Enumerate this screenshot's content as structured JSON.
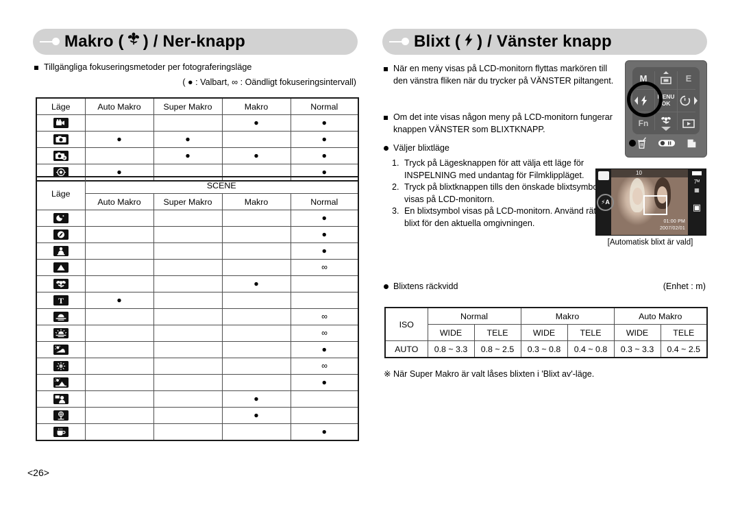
{
  "page": {
    "number": "<26>"
  },
  "left": {
    "header": {
      "title_before": "Makro (",
      "icon": "macro-flower-icon",
      "title_after": ") / Ner-knapp"
    },
    "intro": "Tillgängliga fokuseringsmetoder per fotograferingsläge",
    "legend": "( ● : Valbart,  ∞ : Oändligt fokuseringsintervall)",
    "table1": {
      "headers": [
        "Läge",
        "Auto Makro",
        "Super Makro",
        "Makro",
        "Normal"
      ],
      "rows": [
        {
          "icon": "movie-clip-icon",
          "cells": [
            "",
            "",
            "●",
            "●"
          ]
        },
        {
          "icon": "auto-camera-icon",
          "cells": [
            "●",
            "●",
            "",
            "●"
          ]
        },
        {
          "icon": "program-camera-icon",
          "cells": [
            "",
            "●",
            "●",
            "●"
          ]
        },
        {
          "icon": "voice-recording-icon",
          "cells": [
            "●",
            "",
            "",
            "●"
          ]
        }
      ]
    },
    "table2": {
      "mode_label": "Läge",
      "group_header": "SCENE",
      "sub_headers": [
        "Auto Makro",
        "Super Makro",
        "Makro",
        "Normal"
      ],
      "rows": [
        {
          "icon": "night-icon",
          "cells": [
            "",
            "",
            "",
            "●"
          ]
        },
        {
          "icon": "portrait-icon",
          "cells": [
            "",
            "",
            "",
            "●"
          ]
        },
        {
          "icon": "children-icon",
          "cells": [
            "",
            "",
            "",
            "●"
          ]
        },
        {
          "icon": "landscape-icon",
          "cells": [
            "",
            "",
            "",
            "∞"
          ]
        },
        {
          "icon": "close-up-icon",
          "cells": [
            "",
            "",
            "●",
            ""
          ]
        },
        {
          "icon": "text-icon",
          "cells": [
            "●",
            "",
            "",
            ""
          ]
        },
        {
          "icon": "sunset-icon",
          "cells": [
            "",
            "",
            "",
            "∞"
          ]
        },
        {
          "icon": "dawn-icon",
          "cells": [
            "",
            "",
            "",
            "∞"
          ]
        },
        {
          "icon": "backlight-icon",
          "cells": [
            "",
            "",
            "",
            "●"
          ]
        },
        {
          "icon": "fireworks-icon",
          "cells": [
            "",
            "",
            "",
            "∞"
          ]
        },
        {
          "icon": "beach-snow-icon",
          "cells": [
            "",
            "",
            "",
            "●"
          ]
        },
        {
          "icon": "self-shot-icon",
          "cells": [
            "",
            "",
            "●",
            ""
          ]
        },
        {
          "icon": "food-icon",
          "cells": [
            "",
            "",
            "●",
            ""
          ]
        },
        {
          "icon": "cafe-icon",
          "cells": [
            "",
            "",
            "",
            "●"
          ]
        }
      ]
    }
  },
  "right": {
    "header": {
      "title_before": "Blixt (",
      "icon": "flash-bolt-icon",
      "title_after": ") / Vänster knapp"
    },
    "bullet1": "När en meny visas på LCD-monitorn flyttas markören till den vänstra fliken när du trycker på VÄNSTER piltangent.",
    "bullet2": "Om det inte visas någon meny på LCD-monitorn fungerar knappen VÄNSTER som BLIXTKNAPP.",
    "select_flash_mode": "Väljer blixtläge",
    "steps": [
      {
        "num": "1.",
        "text": "Tryck på Lägesknappen för att välja ett läge för INSPELNING med undantag för Filmklippläget."
      },
      {
        "num": "2.",
        "text": "Tryck på blixtknappen tills den önskade blixtsymbolen visas på LCD-monitorn."
      },
      {
        "num": "3.",
        "text": "En blixtsymbol visas på LCD-monitorn. Använd rätt blixt för den aktuella omgivningen."
      }
    ],
    "camera_pad": {
      "keys": [
        "M",
        "display-icon",
        "E",
        "left-arrow-icon",
        "flash-bolt-icon",
        "MENU / OK",
        "timer-icon",
        "right-arrow-icon",
        "Fn",
        "macro-flower-icon",
        "play-icon",
        "down-arrow-icon",
        "up-arrow-icon"
      ],
      "menu_label": "MENU",
      "ok_label": "OK",
      "m_label": "M",
      "e_label": "E",
      "fn_label": "Fn",
      "bottom_icons": [
        "delete-trash-icon",
        "e-dial-icon",
        "print-icon"
      ]
    },
    "lcd": {
      "caption": "[Automatisk blixt är vald]",
      "flash_symbol": "⚡A",
      "counter": "10",
      "resolution": "7ᴹ",
      "time": "01:00 PM",
      "date": "2007/02/01"
    },
    "flash_range_label": "Blixtens räckvidd",
    "unit_label": "(Enhet : m)",
    "iso_table": {
      "iso_header": "ISO",
      "groups": [
        "Normal",
        "Makro",
        "Auto Makro"
      ],
      "sub_headers": [
        "WIDE",
        "TELE",
        "WIDE",
        "TELE",
        "WIDE",
        "TELE"
      ],
      "row": {
        "iso": "AUTO",
        "values": [
          "0.8 ~ 3.3",
          "0.8 ~ 2.5",
          "0.3 ~ 0.8",
          "0.4 ~ 0.8",
          "0.3 ~ 3.3",
          "0.4 ~ 2.5"
        ]
      }
    },
    "footnote": "※ När Super Makro är valt låses blixten i 'Blixt av'-läge."
  }
}
